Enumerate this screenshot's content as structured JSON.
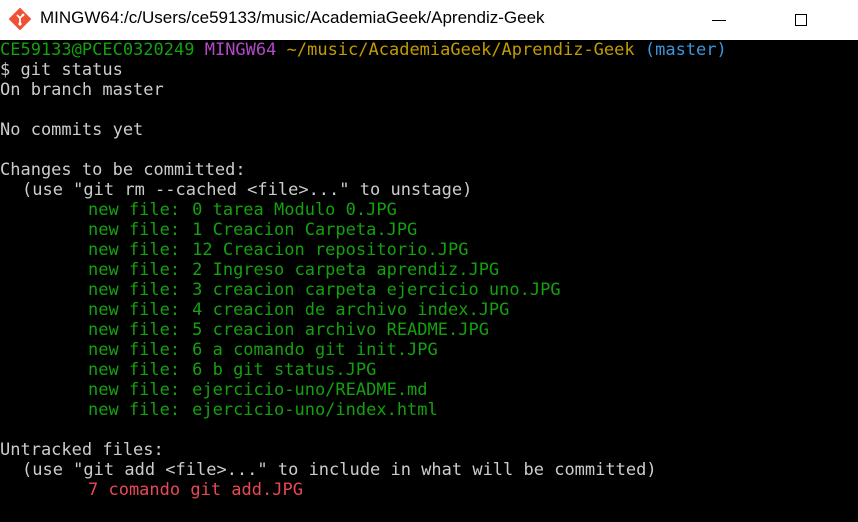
{
  "window": {
    "title": "MINGW64:/c/Users/ce59133/music/AcademiaGeek/Aprendiz-Geek",
    "app_icon": "git-bash-icon",
    "buttons": {
      "minimize_icon": "minimize-icon",
      "maximize_icon": "maximize-icon"
    }
  },
  "terminal": {
    "prompt": {
      "user_host": "CE59133@PCEC0320249",
      "env": "MINGW64",
      "path": "~/music/AcademiaGeek/Aprendiz-Geek",
      "branch": "(master)"
    },
    "command": "$ git status",
    "on_branch": "On branch master",
    "no_commits": "No commits yet",
    "staged_header": "Changes to be committed:",
    "staged_hint": "(use \"git rm --cached <file>...\" to unstage)",
    "staged_files": [
      {
        "status": "new file:",
        "file": "0 tarea Modulo 0.JPG"
      },
      {
        "status": "new file:",
        "file": "1 Creacion Carpeta.JPG"
      },
      {
        "status": "new file:",
        "file": "12 Creacion repositorio.JPG"
      },
      {
        "status": "new file:",
        "file": "2 Ingreso carpeta aprendiz.JPG"
      },
      {
        "status": "new file:",
        "file": "3 creacion carpeta ejercicio uno.JPG"
      },
      {
        "status": "new file:",
        "file": "4 creacion de archivo index.JPG"
      },
      {
        "status": "new file:",
        "file": "5 creacion archivo README.JPG"
      },
      {
        "status": "new file:",
        "file": "6 a comando git init.JPG"
      },
      {
        "status": "new file:",
        "file": "6 b git status.JPG"
      },
      {
        "status": "new file:",
        "file": "ejercicio-uno/README.md"
      },
      {
        "status": "new file:",
        "file": "ejercicio-uno/index.html"
      }
    ],
    "untracked_header": "Untracked files:",
    "untracked_hint": "(use \"git add <file>...\" to include in what will be committed)",
    "untracked_files": [
      "7 comando git add.JPG"
    ],
    "colors": {
      "background": "#000000",
      "text": "#cccccc",
      "green": "#13a10e",
      "magenta": "#b148c6",
      "yellow": "#c19c00",
      "cyan": "#3a96dd",
      "red": "#e74856"
    }
  }
}
